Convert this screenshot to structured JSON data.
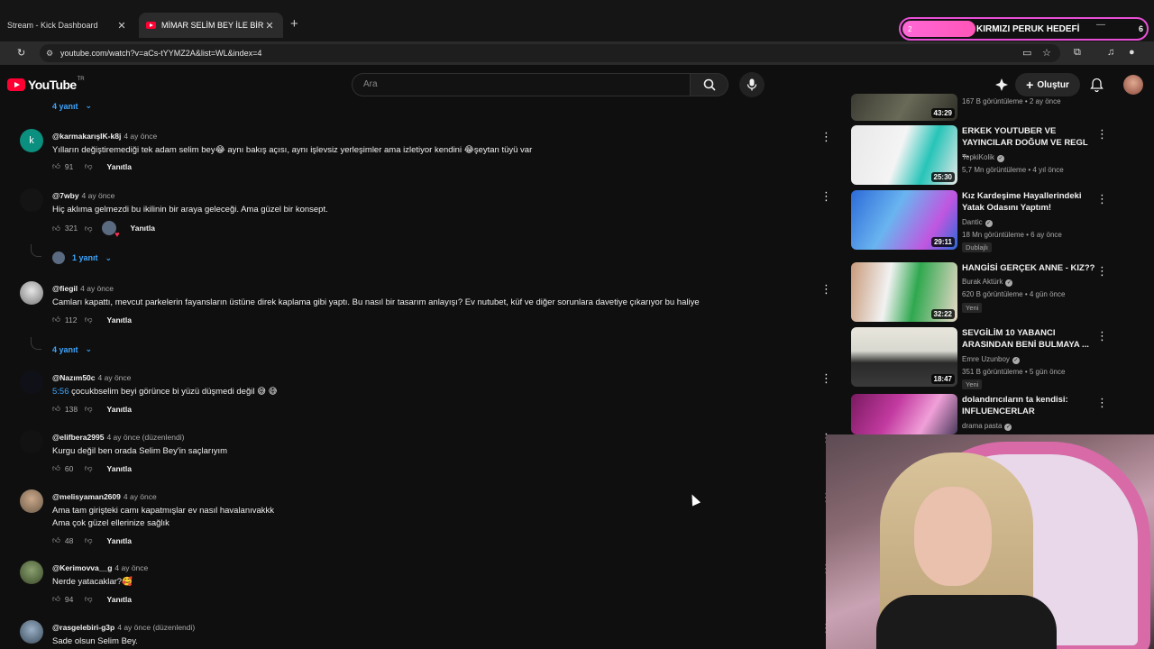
{
  "browser": {
    "tabs": [
      {
        "label": "Stream - Kick Dashboard"
      },
      {
        "label": "MİMAR SELİM BEY İLE BİR TAKI"
      }
    ],
    "url": "youtube.com/watch?v=aCs-tYYMZ2A&list=WL&index=4"
  },
  "overlay": {
    "goal_label": "KIRMIZI PERUK HEDEFİ",
    "goal_current": "2",
    "goal_target": "6",
    "goal_progress_fraction": 0.3
  },
  "youtube": {
    "logo_text": "YouTube",
    "logo_region": "TR",
    "search_placeholder": "Ara",
    "create_label": "Oluştur"
  },
  "comments": {
    "top_replies_label": "4 yanıt",
    "items": [
      {
        "author": "@karmakarışIK-k8j",
        "time": "4 ay önce",
        "lines": [
          "Yılların değiştiremediği tek adam selim bey😂 aynı bakış açısı, aynı işlevsiz yerleşimler ama izletiyor kendini 😂şeytan tüyü var"
        ],
        "likes": "91",
        "reply_label": "Yanıtla",
        "avatar_letter": "k",
        "avatar_color": "#0b8f7e"
      },
      {
        "author": "@7wby",
        "time": "4 ay önce",
        "lines": [
          "Hiç aklıma gelmezdi bu ikilinin bir araya geleceği. Ama güzel bir konsept."
        ],
        "likes": "321",
        "reply_label": "Yanıtla",
        "replies_label": "1 yanıt",
        "avatar_color": "#141414"
      },
      {
        "author": "@fiegil",
        "time": "4 ay önce",
        "lines": [
          "Camları kapattı, mevcut parkelerin fayansların üstüne direk kaplama gibi yaptı. Bu nasıl bir tasarım anlayışı? Ev nutubet, küf ve diğer sorunlara davetiye çıkarıyor bu haliye"
        ],
        "likes": "112",
        "reply_label": "Yanıtla",
        "replies_label": "4 yanıt",
        "avatar_color": "#d0d0d0"
      },
      {
        "author": "@Nazım50c",
        "time": "4 ay önce",
        "timestamp_link": "5:56",
        "lines": [
          " çocukbselim beyi görünce bi yüzü düşmedi değil 😅 😅"
        ],
        "likes": "138",
        "reply_label": "Yanıtla",
        "avatar_color": "#101018"
      },
      {
        "author": "@elifbera2995",
        "time": "4 ay önce (düzenlendi)",
        "lines": [
          "Kurgu değil ben orada Selim Bey'in  saçlarıyım"
        ],
        "likes": "60",
        "reply_label": "Yanıtla",
        "avatar_color": "#121212"
      },
      {
        "author": "@melisyaman2609",
        "time": "4 ay önce",
        "lines": [
          "Ama tam girişteki camı kapatmışlar ev nasıl havalanıvakkk",
          "Ama çok güzel ellerinize sağlık"
        ],
        "likes": "48",
        "reply_label": "Yanıtla",
        "avatar_color": "#6b5a48"
      },
      {
        "author": "@Kerimovva__g",
        "time": "4 ay önce",
        "lines": [
          "Nerde yatacaklar?🥰"
        ],
        "likes": "94",
        "reply_label": "Yanıtla",
        "avatar_color": "#4a5a38"
      },
      {
        "author": "@rasgelebiri-g3p",
        "time": "4 ay önce (düzenlendi)",
        "lines": [
          "Sade olsun Selim Bey."
        ],
        "likes": "",
        "reply_label": "Yanıtla",
        "avatar_color": "#5a6a7a"
      }
    ]
  },
  "sidebar": {
    "videos": [
      {
        "title": "",
        "channel": "",
        "meta": "167 B görüntüleme • 2 ay önce",
        "duration": "43:29",
        "badge": "",
        "thumb": [
          "#3b3b33",
          "#6a6a58"
        ]
      },
      {
        "title": "ERKEK YOUTUBER VE YAYINCILAR DOĞUM VE REGL ...",
        "channel": "TepkiKolik",
        "meta": "5,7 Mn görüntüleme • 4 yıl önce",
        "duration": "25:30",
        "badge": "",
        "thumb": [
          "#e8e8e8",
          "#27c4b8"
        ]
      },
      {
        "title": "Kız Kardeşime Hayallerindeki Yatak Odasını Yaptım!",
        "channel": "Dantic",
        "meta": "18 Mn görüntüleme • 6 ay önce",
        "duration": "29:11",
        "badge": "Dublajlı",
        "thumb": [
          "#2c6bd8",
          "#c056e0"
        ]
      },
      {
        "title": "HANGİSİ GERÇEK ANNE - KIZ??",
        "channel": "Burak Aktürk",
        "meta": "620 B görüntüleme • 4 gün önce",
        "duration": "32:22",
        "badge": "Yeni",
        "thumb": [
          "#f2f2f2",
          "#2fa84f"
        ]
      },
      {
        "title": "SEVGİLİM 10 YABANCI ARASINDAN BENİ BULMAYA ...",
        "channel": "Emre Uzunboy",
        "meta": "351 B görüntüleme • 5 gün önce",
        "duration": "18:47",
        "badge": "Yeni",
        "thumb": [
          "#d8d8d0",
          "#2a2a2a"
        ]
      },
      {
        "title": "dolandırıcıların ta kendisi: INFLUENCERLAR",
        "channel": "drama pasta",
        "meta": "",
        "duration": "",
        "badge": "",
        "thumb": [
          "#c23aa0",
          "#f0a0d8"
        ]
      }
    ]
  },
  "colors": {
    "background": "#0f0f0f",
    "link": "#3ea6ff",
    "goal_border": "#e94fd6"
  }
}
